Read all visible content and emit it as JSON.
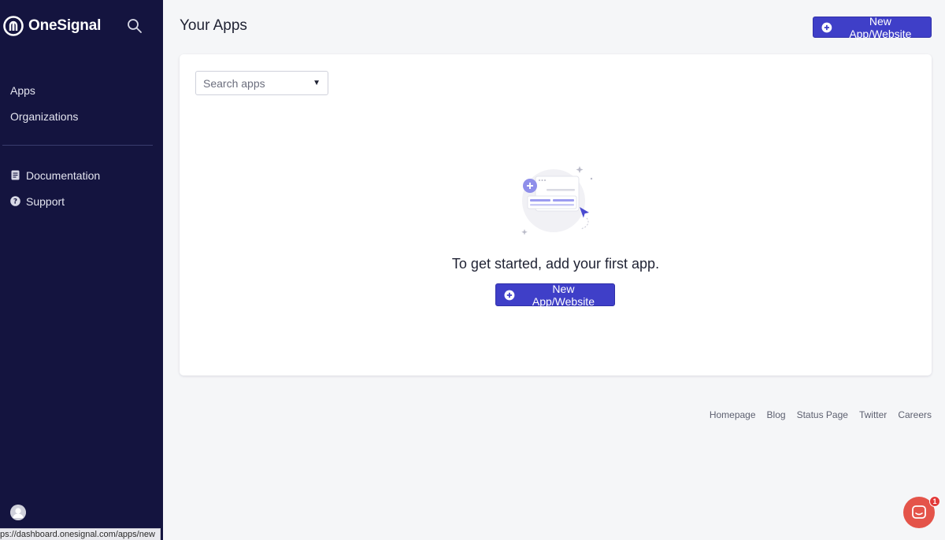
{
  "brand": {
    "name": "OneSignal"
  },
  "sidebar": {
    "primary_items": [
      {
        "label": "Apps"
      },
      {
        "label": "Organizations"
      }
    ],
    "secondary_items": [
      {
        "label": "Documentation",
        "icon": "document-icon"
      },
      {
        "label": "Support",
        "icon": "help-circle-icon"
      }
    ]
  },
  "header": {
    "title": "Your Apps",
    "new_app_label": "New App/Website"
  },
  "main": {
    "search_placeholder": "Search apps",
    "empty_message": "To get started, add your first app.",
    "new_app_label": "New App/Website"
  },
  "footer": {
    "links": [
      "Homepage",
      "Blog",
      "Status Page",
      "Twitter",
      "Careers"
    ]
  },
  "status_bar": {
    "url": "ps://dashboard.onesignal.com/apps/new"
  },
  "chat": {
    "badge_count": "1"
  },
  "colors": {
    "sidebar_bg": "#14143f",
    "primary": "#3f3fc8",
    "page_bg": "#f5f6f8",
    "chat": "#e4544a"
  }
}
